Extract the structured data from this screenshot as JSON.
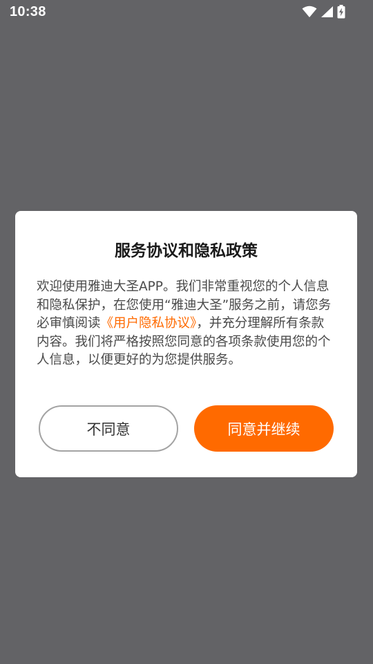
{
  "status_bar": {
    "time": "10:38",
    "icons": [
      "wifi-icon",
      "cell-signal-icon",
      "battery-charging-icon"
    ]
  },
  "dialog": {
    "title": "服务协议和隐私政策",
    "body_before_link": "欢迎使用雅迪大圣APP。我们非常重视您的个人信息和隐私保护，在您使用“雅迪大圣”服务之前，请您务必审慎阅读",
    "policy_link": "《用户隐私协议》",
    "body_after_link": "，并充分理解所有条款内容。我们将严格按照您同意的各项条款使用您的个人信息，以便更好的为您提供服务。",
    "disagree_label": "不同意",
    "agree_label": "同意并继续"
  },
  "colors": {
    "backdrop": "#636366",
    "accent": "#ff6a00",
    "dialog_bg": "#ffffff"
  }
}
